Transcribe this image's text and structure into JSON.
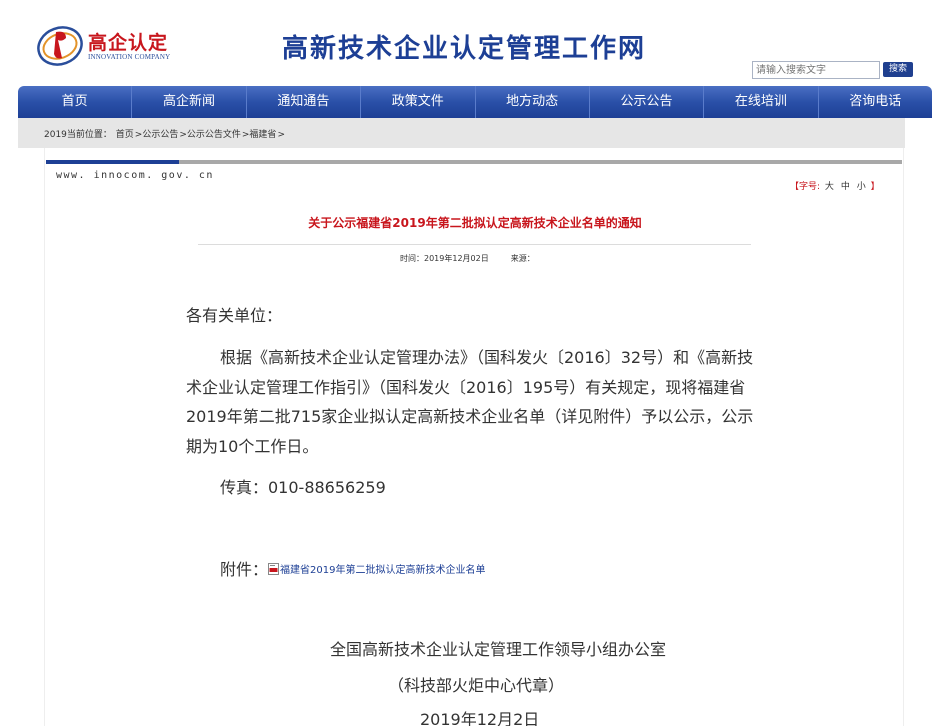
{
  "header": {
    "logo_text": "高企认定",
    "logo_sub": "INNOVATION COMPANY",
    "site_title": "高新技术企业认定管理工作网",
    "search_placeholder": "请输入搜索文字",
    "search_button": "搜索"
  },
  "nav": {
    "items": [
      "首页",
      "高企新闻",
      "通知通告",
      "政策文件",
      "地方动态",
      "公示公告",
      "在线培训",
      "咨询电话"
    ]
  },
  "breadcrumb": {
    "label": "2019当前位置：",
    "items": [
      "首页",
      ">公示公告",
      ">公示公告文件",
      ">福建省",
      ">"
    ]
  },
  "article": {
    "site_url": "www. innocom. gov. cn",
    "font_size_label": "【字号:",
    "font_sizes": [
      "大",
      "中",
      "小"
    ],
    "font_size_close": "】",
    "title": "关于公示福建省2019年第二批拟认定高新技术企业名单的通知",
    "time_label": "时间：2019年12月02日",
    "source_label": "来源：",
    "greeting": "各有关单位：",
    "paragraph": "根据《高新技术企业认定管理办法》（国科发火〔2016〕32号）和《高新技术企业认定管理工作指引》（国科发火〔2016〕195号）有关规定，现将福建省2019年第二批715家企业拟认定高新技术企业名单（详见附件）予以公示，公示期为10个工作日。",
    "fax": "传真：010-88656259",
    "attachment_label": "附件：",
    "attachment_link": "福建省2019年第二批拟认定高新技术企业名单",
    "signature_org": "全国高新技术企业认定管理工作领导小组办公室",
    "signature_note": "（科技部火炬中心代章）",
    "signature_date": "2019年12月2日"
  },
  "colors": {
    "brand_blue": "#1d3f95",
    "title_red": "#c8161d"
  }
}
